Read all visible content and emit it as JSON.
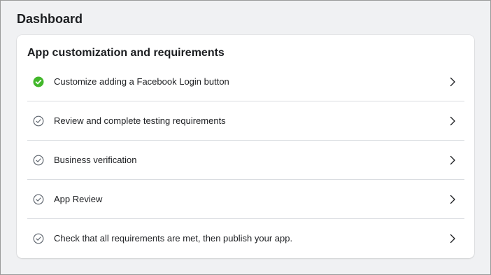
{
  "page": {
    "title": "Dashboard"
  },
  "card": {
    "title": "App customization and requirements",
    "items": [
      {
        "label": "Customize adding a Facebook Login button",
        "status": "complete",
        "icon": "check-circle-filled-icon"
      },
      {
        "label": "Review and complete testing requirements",
        "status": "pending",
        "icon": "check-circle-outline-icon"
      },
      {
        "label": "Business verification",
        "status": "pending",
        "icon": "check-circle-outline-icon"
      },
      {
        "label": "App Review",
        "status": "pending",
        "icon": "check-circle-outline-icon"
      },
      {
        "label": "Check that all requirements are met, then publish your app.",
        "status": "pending",
        "icon": "check-circle-outline-icon"
      }
    ]
  },
  "colors": {
    "complete": "#42b72a",
    "pending": "#606770",
    "divider": "#dadde1",
    "background": "#f0f1f3"
  }
}
